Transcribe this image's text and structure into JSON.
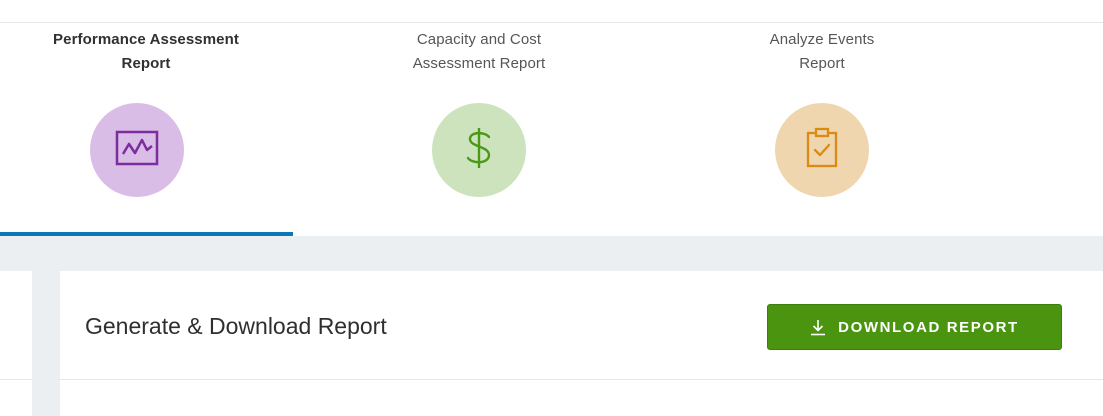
{
  "tabs": [
    {
      "line1": "Performance Assessment",
      "line2": "Report",
      "icon": "performance-chart-icon",
      "active": true,
      "circle_color": "#d9bde6",
      "icon_color": "#7b2d9e"
    },
    {
      "line1": "Capacity and Cost",
      "line2": "Assessment Report",
      "icon": "dollar-icon",
      "active": false,
      "circle_color": "#cde3bd",
      "icon_color": "#4a9a16"
    },
    {
      "line1": "Analyze Events",
      "line2": "Report",
      "icon": "clipboard-check-icon",
      "active": false,
      "circle_color": "#f0d6ae",
      "icon_color": "#d98b14"
    }
  ],
  "card": {
    "title": "Generate & Download Report",
    "download_button": {
      "label": "DOWNLOAD REPORT",
      "icon": "download-icon"
    }
  },
  "colors": {
    "active_underline": "#0b78b5",
    "button_green": "#4a9410",
    "background_grey": "#eceff1"
  }
}
